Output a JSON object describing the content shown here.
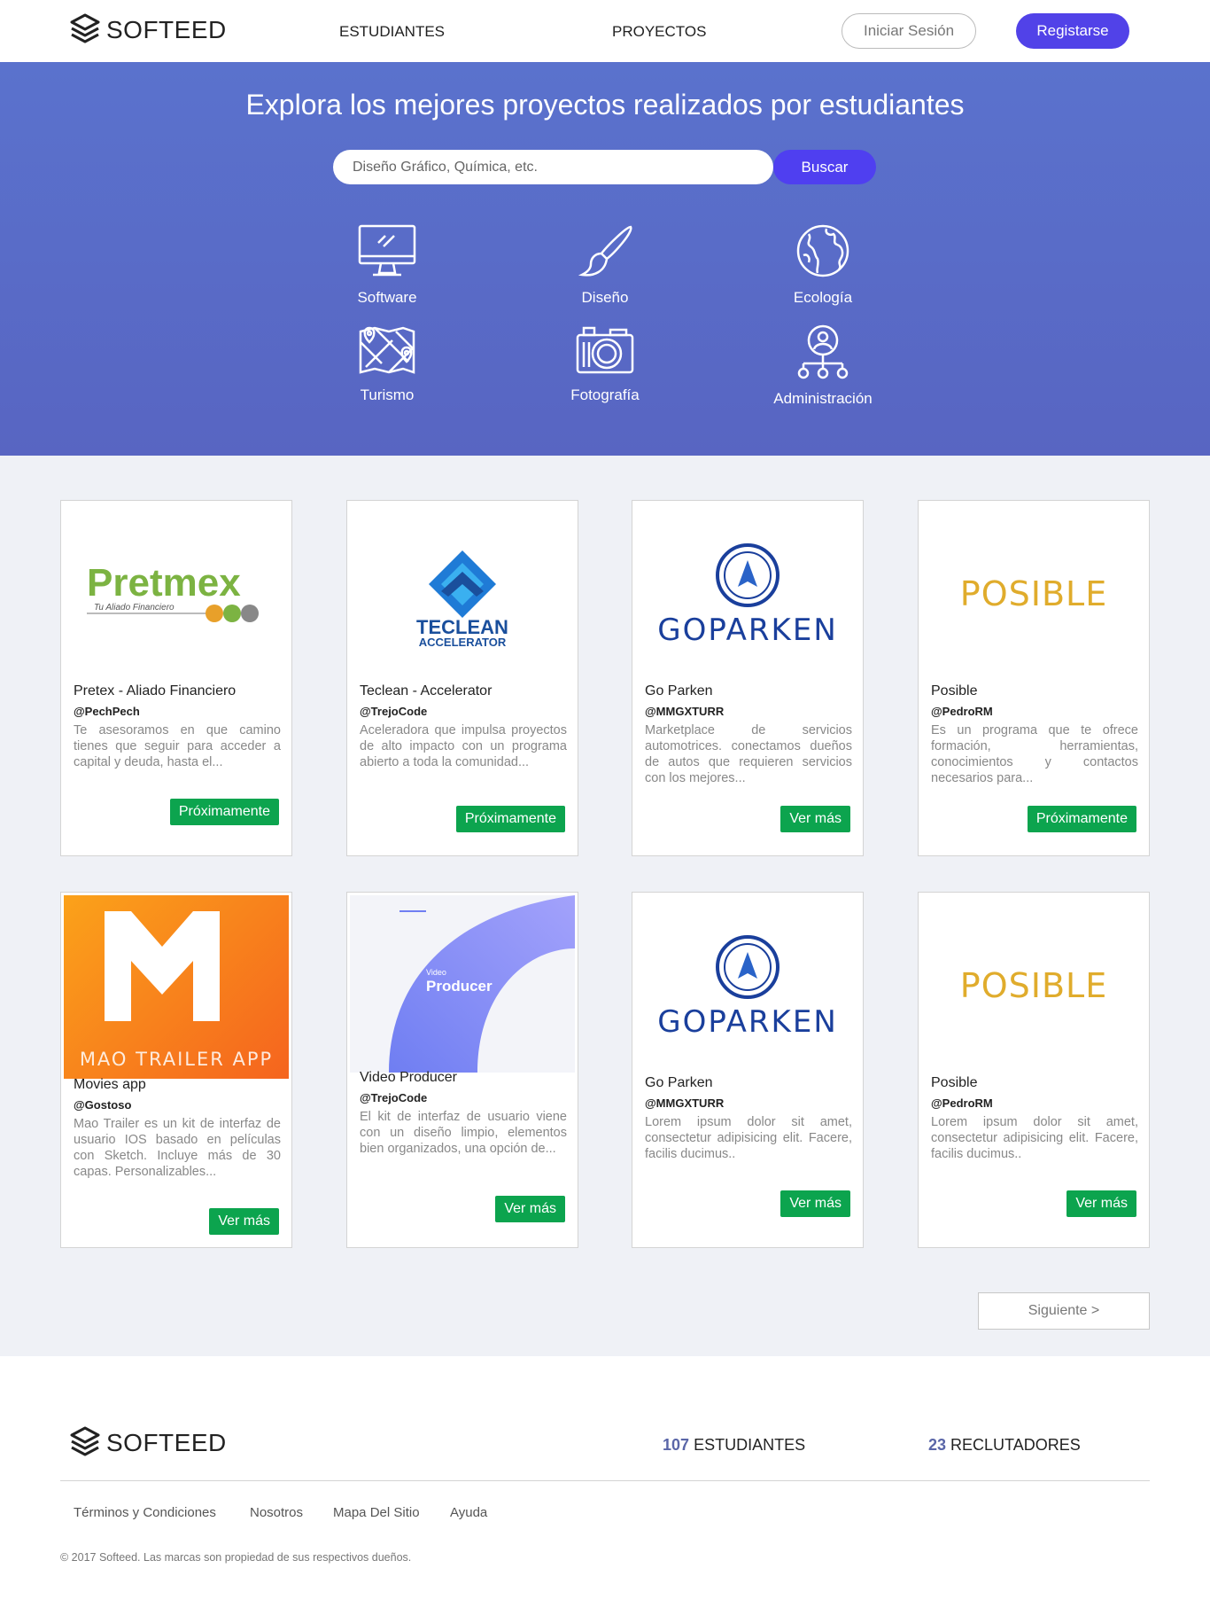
{
  "header": {
    "logo_text": "SOFTEED",
    "nav": [
      "ESTUDIANTES",
      "PROYECTOS"
    ],
    "login_label": "Iniciar Sesión",
    "register_label": "Registarse"
  },
  "hero": {
    "title": "Explora los mejores proyectos realizados por estudiantes",
    "search_placeholder": "Diseño Gráfico, Química, etc.",
    "search_button": "Buscar",
    "categories": [
      {
        "label": "Software",
        "icon": "monitor-icon"
      },
      {
        "label": "Diseño",
        "icon": "brush-icon"
      },
      {
        "label": "Ecología",
        "icon": "globe-icon"
      },
      {
        "label": "Turismo",
        "icon": "map-icon"
      },
      {
        "label": "Fotografía",
        "icon": "camera-icon"
      },
      {
        "label": "Administración",
        "icon": "org-chart-icon"
      }
    ]
  },
  "projects": [
    {
      "title": "Pretex - Aliado Financiero",
      "user": "@PechPech",
      "desc": "Te asesoramos en que camino tienes que seguir para acceder a capital y deuda, hasta el...",
      "button": "Próximamente",
      "logo": {
        "main": "Pretmex",
        "tagline": "Tu Aliado Financiero"
      }
    },
    {
      "title": "Teclean - Accelerator",
      "user": "@TrejoCode",
      "desc": "Aceleradora que impulsa proyectos de alto impacto con un programa abierto a toda la comunidad...",
      "button": "Próximamente",
      "logo": {
        "main": "TECLEAN",
        "tagline": "ACCELERATOR"
      }
    },
    {
      "title": "Go Parken",
      "user": "@MMGXTURR",
      "desc": "Marketplace de servicios automotrices. conectamos dueños de autos que requieren servicios con los mejores...",
      "button": "Ver más",
      "logo": {
        "main": "GOPARKEN"
      }
    },
    {
      "title": "Posible",
      "user": "@PedroRM",
      "desc": "Es un programa que te ofrece formación, herramientas, conocimientos y contactos necesarios para...",
      "button": "Próximamente",
      "logo": {
        "main": "POSIBLE"
      }
    },
    {
      "title": "Movies app",
      "user": "@Gostoso",
      "desc": "Mao Trailer es un kit de interfaz de usuario IOS basado en películas con Sketch. Incluye más de 30 capas. Personalizables...",
      "button": "Ver más",
      "logo": {
        "main": "MAO TRAILER APP"
      }
    },
    {
      "title": "Video Producer",
      "user": "@TrejoCode",
      "desc": "El kit de interfaz de usuario viene con un diseño limpio, elementos bien organizados, una opción de...",
      "button": "Ver más",
      "logo": {
        "main": "Producer",
        "tagline": "Video"
      }
    },
    {
      "title": "Go Parken",
      "user": "@MMGXTURR",
      "desc": "Lorem ipsum dolor sit amet, consectetur adipisicing elit. Facere, facilis ducimus..",
      "button": "Ver más",
      "logo": {
        "main": "GOPARKEN"
      }
    },
    {
      "title": "Posible",
      "user": "@PedroRM",
      "desc": "Lorem ipsum dolor sit amet, consectetur adipisicing elit. Facere, facilis ducimus..",
      "button": "Ver más",
      "logo": {
        "main": "POSIBLE"
      }
    }
  ],
  "pagination": {
    "next_label": "Siguiente >"
  },
  "footer": {
    "logo_text": "SOFTEED",
    "students_count": "107",
    "students_label": "ESTUDIANTES",
    "recruiters_count": "23",
    "recruiters_label": "RECLUTADORES",
    "links": [
      "Términos y Condiciones",
      "Nosotros",
      "Mapa Del Sitio",
      "Ayuda"
    ],
    "copyright": "© 2017 Softeed. Las marcas son propiedad de sus respectivos dueños."
  },
  "colors": {
    "primary": "#5142e8",
    "hero": "#5a6bc9",
    "button_green": "#0ca44e",
    "posible_gold": "#e0ac2c",
    "goparken_blue": "#1a3f9c"
  }
}
